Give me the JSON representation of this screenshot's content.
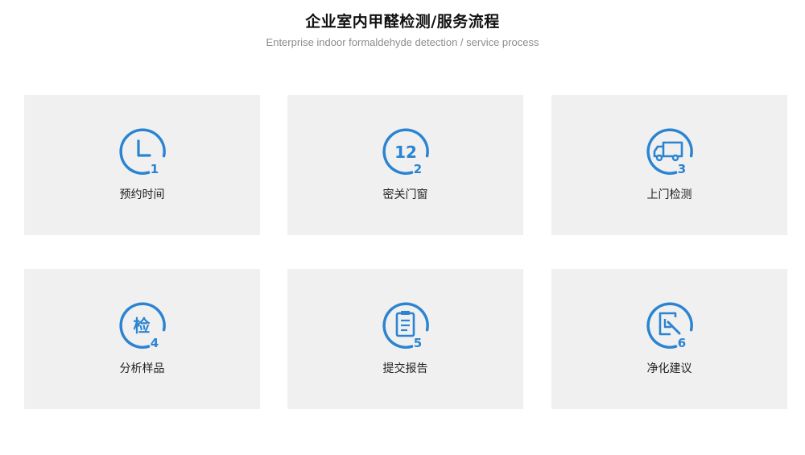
{
  "header": {
    "title": "企业室内甲醛检测/服务流程",
    "subtitle": "Enterprise indoor formaldehyde detection / service process"
  },
  "theme": {
    "accent": "#2a84d2",
    "card_background": "#f0f0f0"
  },
  "steps": [
    {
      "number": "1",
      "label": "预约时间",
      "icon": "clock-icon"
    },
    {
      "number": "2",
      "label": "密关门窗",
      "icon": "clock-12-icon",
      "icon_text": "12"
    },
    {
      "number": "3",
      "label": "上门检测",
      "icon": "truck-icon"
    },
    {
      "number": "4",
      "label": "分析样品",
      "icon": "analysis-icon",
      "icon_text": "检"
    },
    {
      "number": "5",
      "label": "提交报告",
      "icon": "clipboard-icon"
    },
    {
      "number": "6",
      "label": "净化建议",
      "icon": "edit-icon"
    }
  ]
}
